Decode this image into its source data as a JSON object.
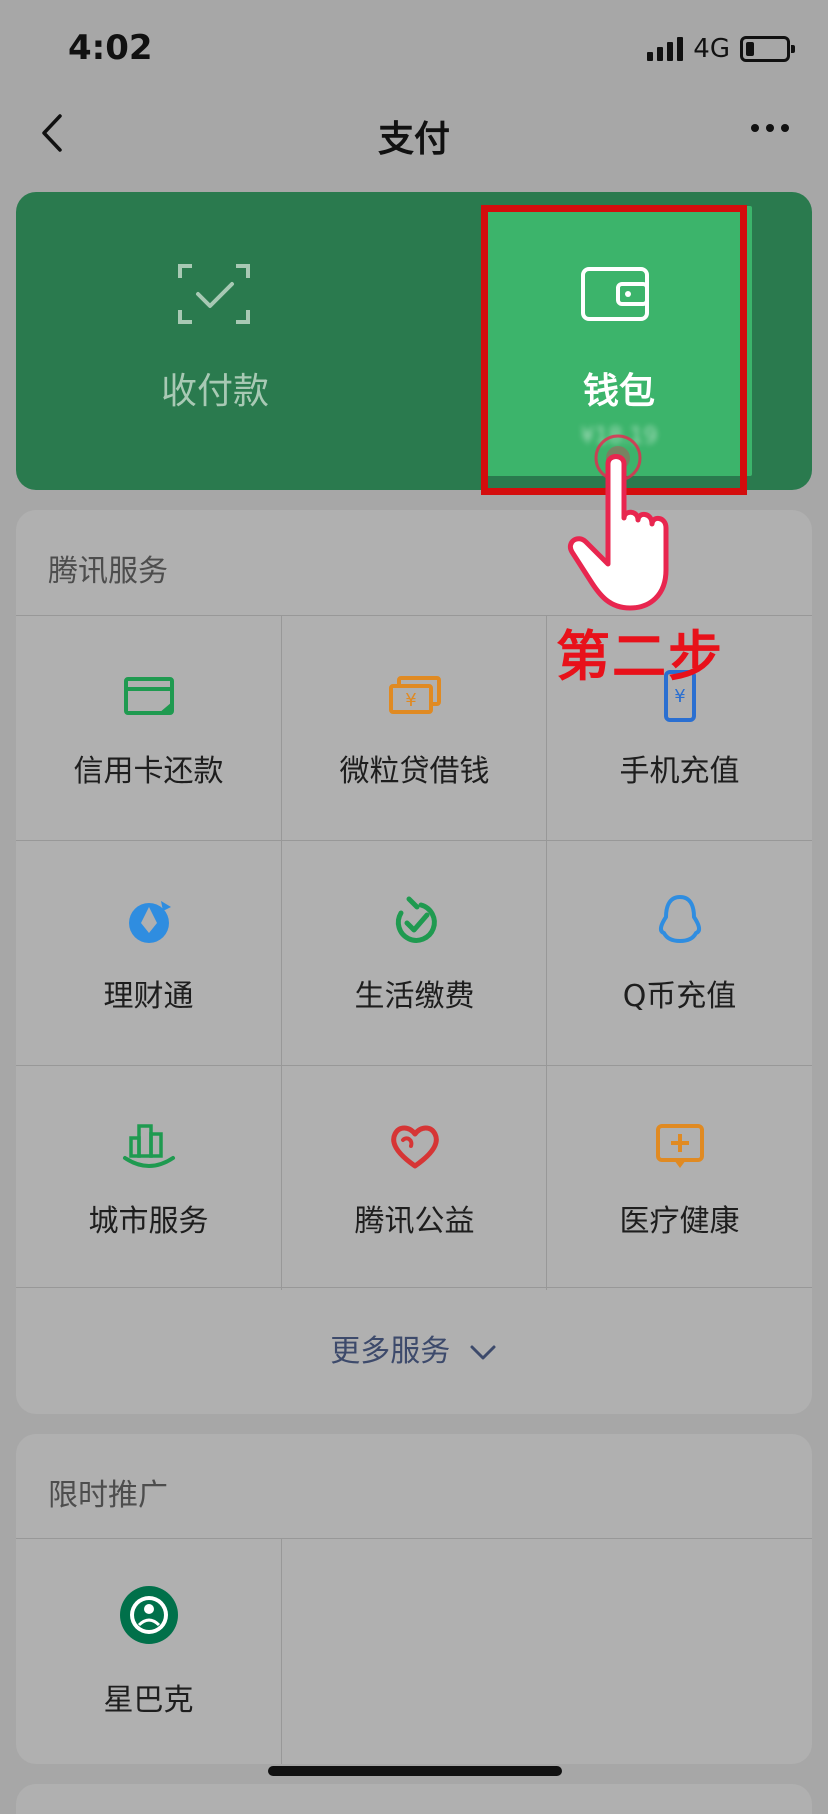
{
  "status_bar": {
    "time": "4:02",
    "network": "4G"
  },
  "nav": {
    "title": "支付"
  },
  "pay_card": {
    "receive_label": "收付款",
    "wallet_label": "钱包",
    "wallet_balance": "¥18.19"
  },
  "services": {
    "title": "腾讯服务",
    "items": [
      {
        "label": "信用卡还款",
        "icon": "credit-card-icon",
        "color": "#1f9a50"
      },
      {
        "label": "微粒贷借钱",
        "icon": "money-bills-icon",
        "color": "#e08a22"
      },
      {
        "label": "手机充值",
        "icon": "mobile-phone-icon",
        "color": "#2a6fd1"
      },
      {
        "label": "理财通",
        "icon": "wealth-icon",
        "color": "#2f8de0"
      },
      {
        "label": "生活缴费",
        "icon": "utilities-icon",
        "color": "#1f9a50"
      },
      {
        "label": "Q币充值",
        "icon": "penguin-icon",
        "color": "#2f8de0"
      },
      {
        "label": "城市服务",
        "icon": "city-icon",
        "color": "#1f9a50"
      },
      {
        "label": "腾讯公益",
        "icon": "charity-heart-icon",
        "color": "#d63535"
      },
      {
        "label": "医疗健康",
        "icon": "medical-icon",
        "color": "#e08a22"
      }
    ],
    "more_label": "更多服务"
  },
  "promo": {
    "title": "限时推广",
    "items": [
      {
        "label": "星巴克",
        "icon": "starbucks-icon"
      }
    ]
  },
  "annotation": {
    "step_label": "第二步"
  }
}
